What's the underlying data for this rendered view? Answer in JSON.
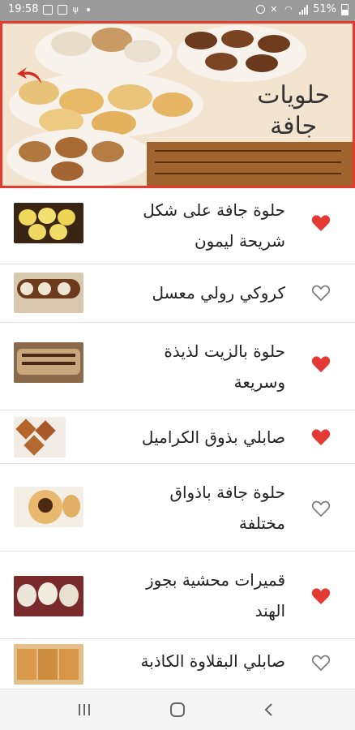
{
  "status_bar": {
    "time": "19:58",
    "battery": "51%",
    "icons_left": [
      "gallery-icon",
      "linkedin-icon",
      "usb-icon",
      "dot-icon"
    ],
    "icons_right": [
      "alarm-icon",
      "mute-icon",
      "wifi-icon",
      "signal-icon",
      "battery-icon"
    ]
  },
  "banner": {
    "title_line1": "حلويات",
    "title_line2": "جافة",
    "border_color": "#e63a2e"
  },
  "recipes": [
    {
      "title_line1": "حلوة جافة على شكل",
      "title_line2": "شريحة ليمون",
      "favorite": true
    },
    {
      "title_line1": "كروكي رولي معسل",
      "title_line2": "",
      "favorite": false
    },
    {
      "title_line1": "حلوة بالزيت لذيذة",
      "title_line2": "وسريعة",
      "favorite": true
    },
    {
      "title_line1": "صابلي بذوق الكراميل",
      "title_line2": "",
      "favorite": true
    },
    {
      "title_line1": "حلوة جافة باذواق",
      "title_line2": "مختلفة",
      "favorite": false
    },
    {
      "title_line1": "قميرات محشية بجوز",
      "title_line2": "الهند",
      "favorite": true
    },
    {
      "title_line1": "صابلي البقلاوة الكاذبة",
      "title_line2": "",
      "favorite": false
    }
  ],
  "colors": {
    "heart_active": "#e53935",
    "heart_inactive": "#777777"
  },
  "nav": {
    "buttons": [
      "recent-apps-icon",
      "home-icon",
      "back-icon"
    ]
  }
}
